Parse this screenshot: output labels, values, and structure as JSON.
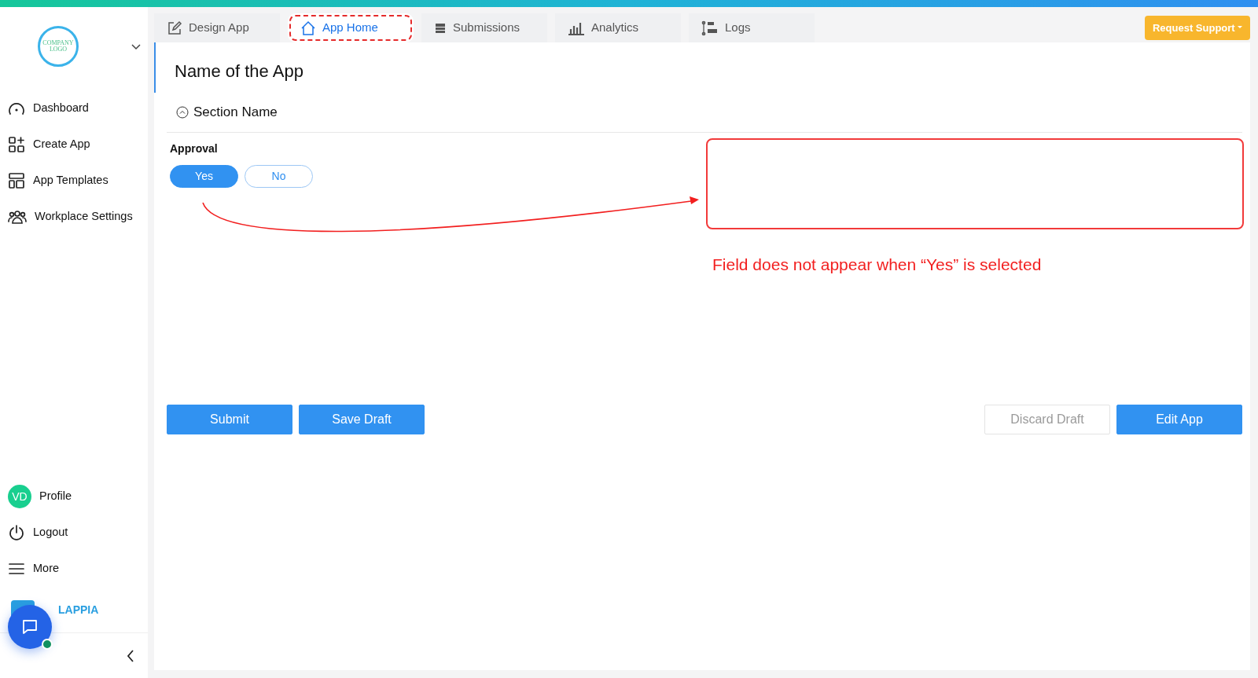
{
  "sidebar": {
    "logo_text": "COMPANY LOGO",
    "items": [
      {
        "label": "Dashboard"
      },
      {
        "label": "Create App"
      },
      {
        "label": "App Templates"
      },
      {
        "label": "Workplace Settings"
      }
    ],
    "profile": {
      "initials": "VD",
      "label": "Profile"
    },
    "bottom_items": [
      {
        "label": "Logout"
      },
      {
        "label": "More"
      }
    ],
    "brand": "LAPPIA"
  },
  "tabs": [
    {
      "label": "Design App",
      "selected": false,
      "highlighted": false
    },
    {
      "label": "App Home",
      "selected": true,
      "highlighted": true
    },
    {
      "label": "Submissions",
      "selected": false,
      "highlighted": false
    },
    {
      "label": "Analytics",
      "selected": false,
      "highlighted": false
    },
    {
      "label": "Logs",
      "selected": false,
      "highlighted": false
    }
  ],
  "request_support": "Request Support",
  "app_title": "Name of the App",
  "section": {
    "name": "Section Name",
    "expanded": true
  },
  "approval": {
    "label": "Approval",
    "options": [
      {
        "label": "Yes",
        "selected": true
      },
      {
        "label": "No",
        "selected": false
      }
    ]
  },
  "buttons": [
    {
      "label": "Submit",
      "kind": "primary"
    },
    {
      "label": "Save Draft",
      "kind": "primary"
    },
    {
      "label": "Discard Draft",
      "kind": "secondary"
    },
    {
      "label": "Edit App",
      "kind": "primary"
    }
  ],
  "annotation": {
    "text": "Field does not appear when “Yes” is selected"
  }
}
